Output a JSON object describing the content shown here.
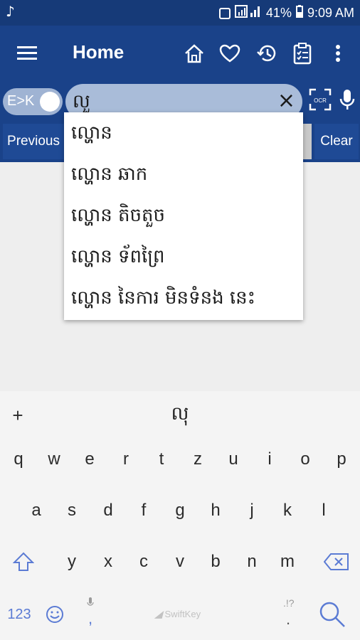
{
  "status_bar": {
    "time": "9:09 AM",
    "battery": "41%"
  },
  "app_bar": {
    "title": "Home"
  },
  "search": {
    "toggle_label": "E>K",
    "value": "លួ",
    "clear_icon": "×"
  },
  "buttons": {
    "previous": "Previous",
    "clear": "Clear"
  },
  "suggestions": [
    "ល្ហោន",
    "ល្ហោន ឆាក",
    "ល្ហោន តិចតួច",
    "ល្ហោន ទ័ពព្រៃ",
    "ល្ហោន នៃការ មិនទំនង នេះ"
  ],
  "keyboard": {
    "plus": "+",
    "candidate": "លុ",
    "row1": [
      "q",
      "w",
      "e",
      "r",
      "t",
      "z",
      "u",
      "i",
      "o",
      "p"
    ],
    "row2": [
      "a",
      "s",
      "d",
      "f",
      "g",
      "h",
      "j",
      "k",
      "l"
    ],
    "row3": [
      "y",
      "x",
      "c",
      "v",
      "b",
      "n",
      "m"
    ],
    "numbers_key": "123",
    "comma": ",",
    "punct_hint": ".!?",
    "period": ".",
    "brand": "SwiftKey"
  }
}
